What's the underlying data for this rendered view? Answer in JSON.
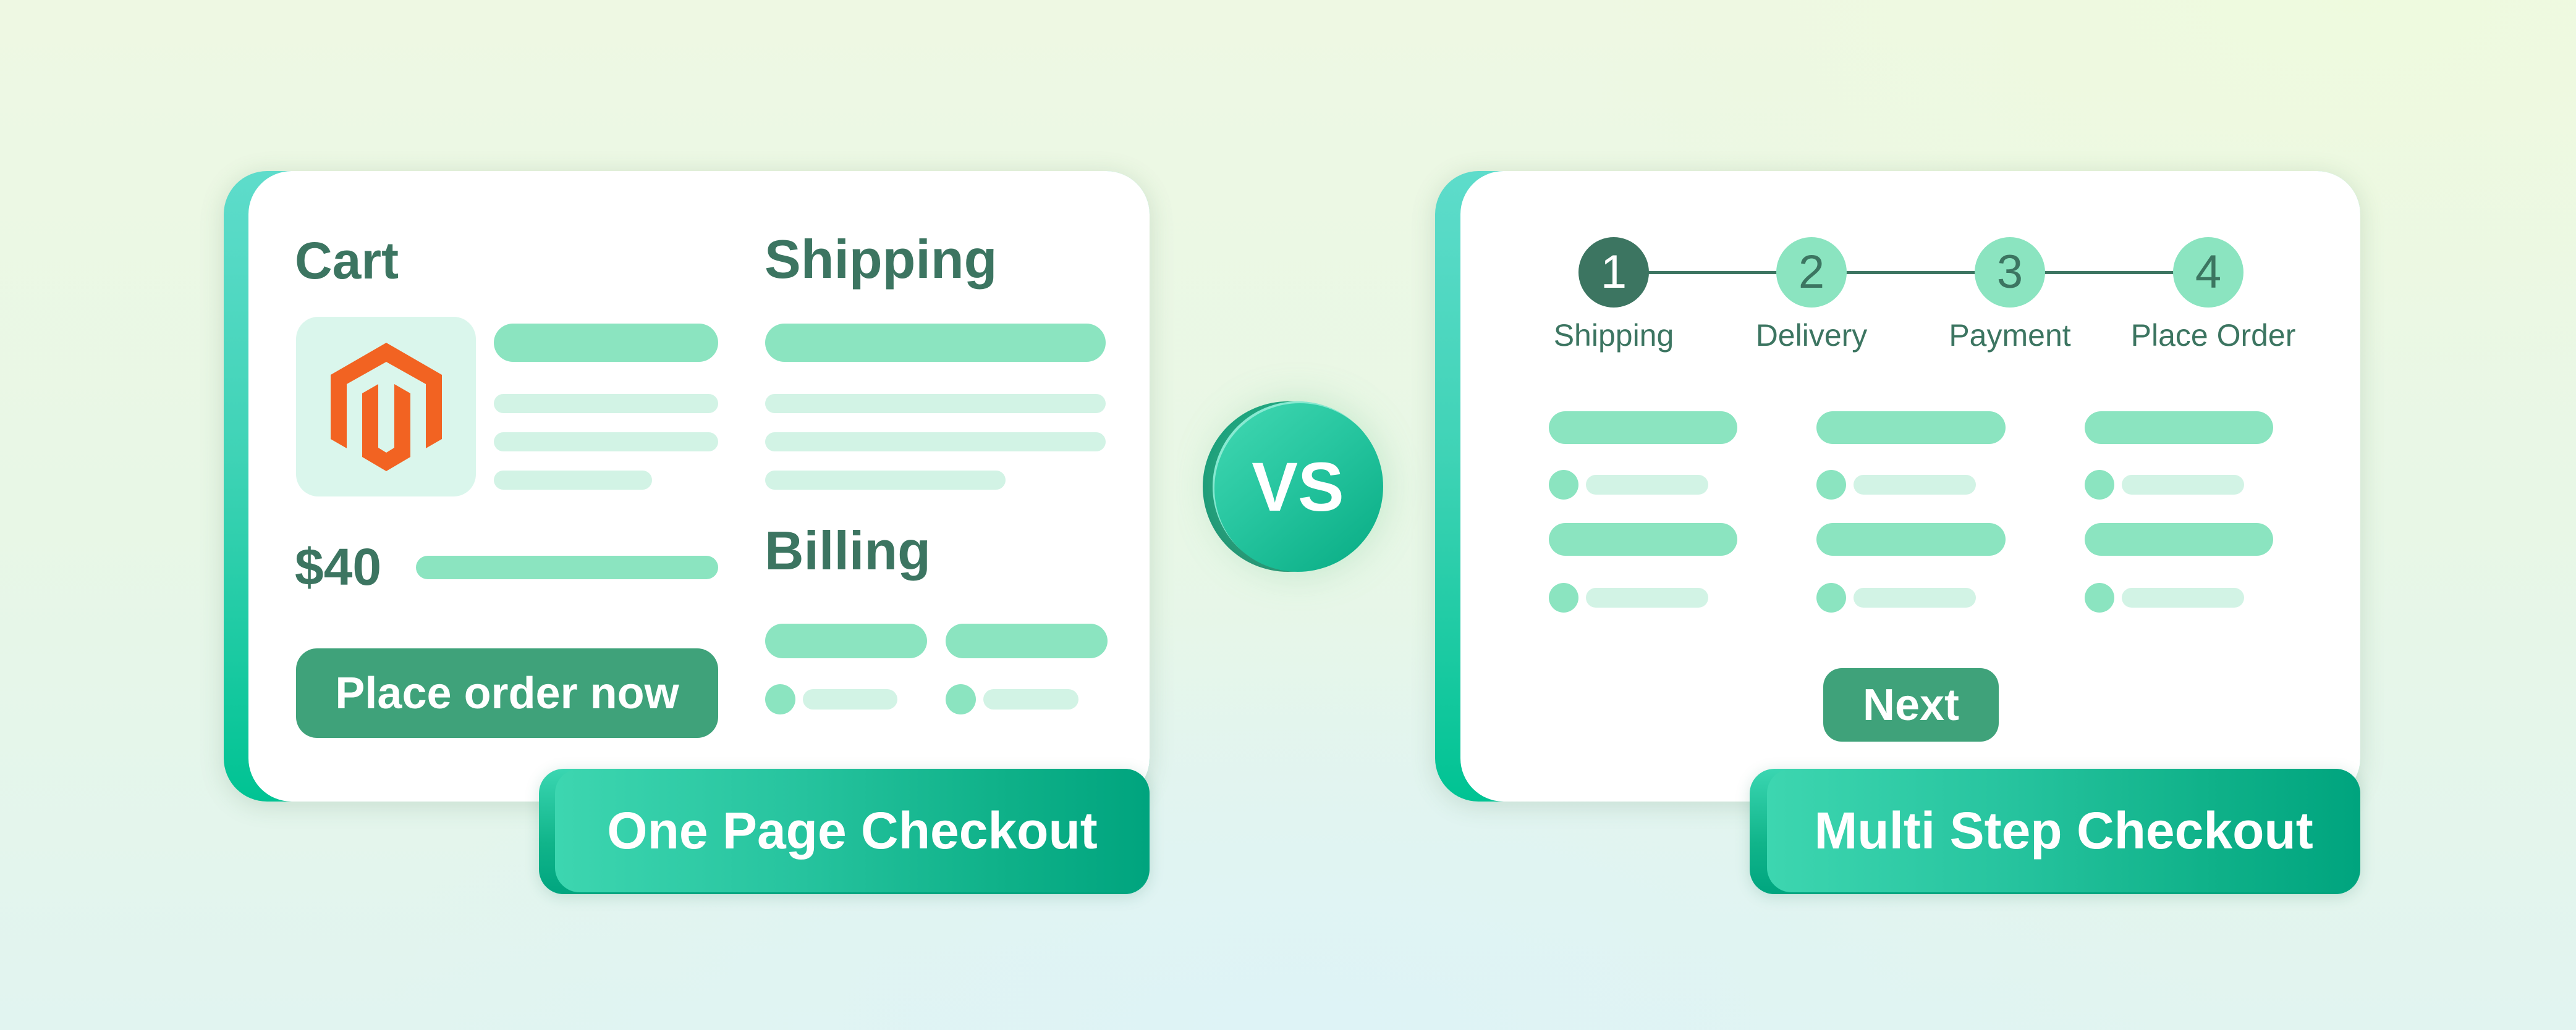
{
  "colors": {
    "heading": "#3c7561",
    "accent_strong": "#8be4c0",
    "accent_light": "#d2f3e5",
    "button": "#3fa27a",
    "magento_orange": "#f26322",
    "logo_box": "#daf6ec"
  },
  "badge": {
    "label": "VS"
  },
  "one_page": {
    "title": "One Page Checkout",
    "cart_heading": "Cart",
    "shipping_heading": "Shipping",
    "billing_heading": "Billing",
    "price": "$40",
    "place_order_label": "Place order now",
    "product_icon": "magento-logo-icon"
  },
  "multi_step": {
    "title": "Multi Step Checkout",
    "next_label": "Next",
    "current_step": 1,
    "steps": [
      {
        "number": "1",
        "label": "Shipping",
        "state": "active"
      },
      {
        "number": "2",
        "label": "Delivery",
        "state": "pending"
      },
      {
        "number": "3",
        "label": "Payment",
        "state": "pending"
      },
      {
        "number": "4",
        "label": "Place Order",
        "state": "pending"
      }
    ]
  }
}
